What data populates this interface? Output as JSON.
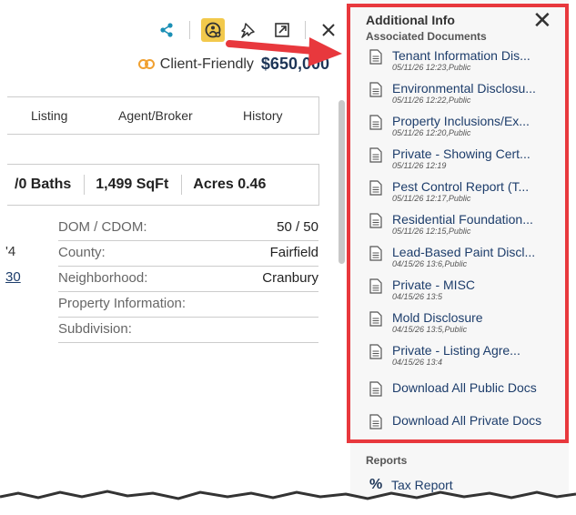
{
  "toolbar": {
    "icons": [
      "share-icon",
      "add-client-icon",
      "pin-icon",
      "open-external-icon",
      "close-icon"
    ]
  },
  "summary": {
    "client_friendly_label": "Client-Friendly",
    "price": "$650,000"
  },
  "tabs": [
    "Listing",
    "Agent/Broker",
    "History"
  ],
  "stats": [
    "/0 Baths",
    "1,499 SqFt",
    "Acres 0.46"
  ],
  "details": [
    {
      "label": "DOM / CDOM:",
      "value": "50 / 50"
    },
    {
      "label": "County:",
      "value": "Fairfield"
    },
    {
      "label": "Neighborhood:",
      "value": "Cranbury"
    },
    {
      "label": "Property Information:",
      "value": ""
    },
    {
      "label": "Subdivision:",
      "value": ""
    }
  ],
  "left_fragments": [
    "'4",
    "30"
  ],
  "panel": {
    "title": "Additional Info",
    "section": "Associated Documents",
    "documents": [
      {
        "title": "Tenant Information Dis...",
        "meta": "05/11/26 12:23,Public"
      },
      {
        "title": "Environmental Disclosu...",
        "meta": "05/11/26 12:22,Public"
      },
      {
        "title": "Property Inclusions/Ex...",
        "meta": "05/11/26 12:20,Public"
      },
      {
        "title": "Private - Showing Cert...",
        "meta": "05/11/26 12:19"
      },
      {
        "title": "Pest Control Report (T...",
        "meta": "05/11/26 12:17,Public"
      },
      {
        "title": "Residential Foundation...",
        "meta": "05/11/26 12:15,Public"
      },
      {
        "title": "Lead-Based Paint Discl...",
        "meta": "04/15/26 13:6,Public"
      },
      {
        "title": "Private - MISC",
        "meta": "04/15/26 13:5"
      },
      {
        "title": "Mold Disclosure",
        "meta": "04/15/26 13:5,Public"
      },
      {
        "title": "Private - Listing Agre...",
        "meta": "04/15/26 13:4"
      }
    ],
    "download_public": "Download All Public Docs",
    "download_private": "Download All Private Docs",
    "reports_heading": "Reports",
    "tax_report": "Tax Report"
  },
  "colors": {
    "annotation_red": "#e8383d",
    "highlight_yellow": "#f2c94c",
    "link_blue": "#1d3d6b",
    "client_friendly_orange": "#f0a030"
  }
}
